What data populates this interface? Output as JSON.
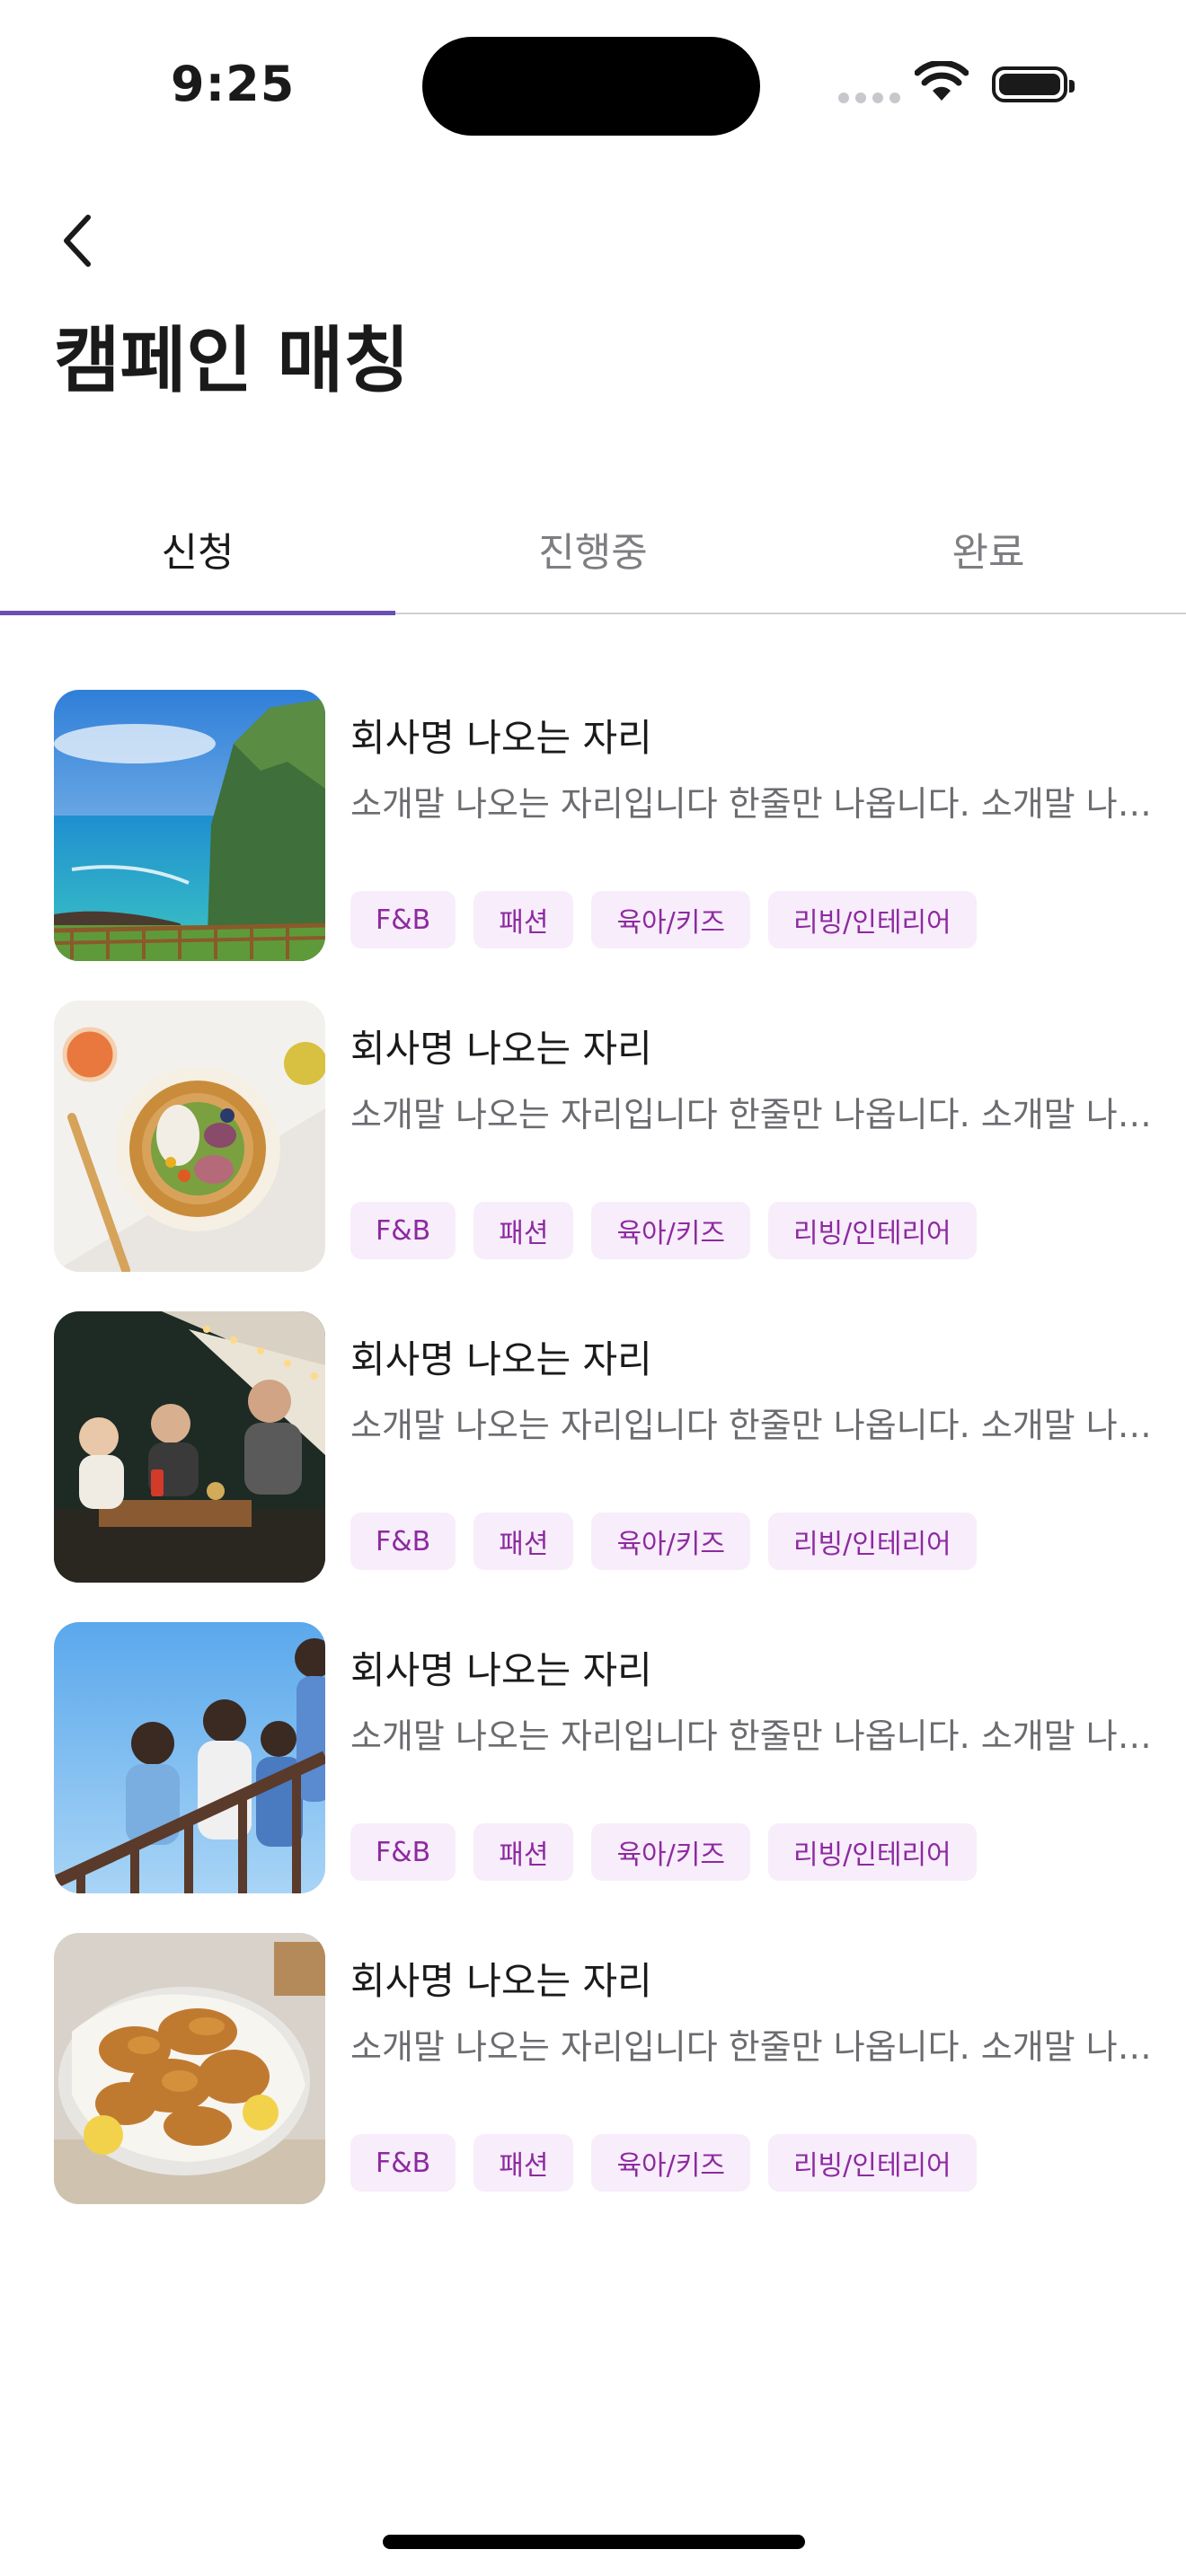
{
  "status": {
    "time": "9:25"
  },
  "header": {
    "title": "캠페인 매칭"
  },
  "tabs": [
    {
      "label": "신청",
      "active": true
    },
    {
      "label": "진행중",
      "active": false
    },
    {
      "label": "완료",
      "active": false
    }
  ],
  "colors": {
    "accent": "#6a4fb5",
    "tag_bg": "#f8edfb",
    "tag_text": "#8d2aa0"
  },
  "items": [
    {
      "title": "회사명 나오는 자리",
      "desc": "소개말 나오는 자리입니다 한줄만 나옵니다. 소개말 나오는 자리입니다",
      "image": "coastal-cliff-photo",
      "tags": [
        "F&B",
        "패션",
        "육아/키즈",
        "리빙/인테리어"
      ]
    },
    {
      "title": "회사명 나오는 자리",
      "desc": "소개말 나오는 자리입니다 한줄만 나옵니다. 소개말 나오는 자리입니다",
      "image": "salad-bowl-photo",
      "tags": [
        "F&B",
        "패션",
        "육아/키즈",
        "리빙/인테리어"
      ]
    },
    {
      "title": "회사명 나오는 자리",
      "desc": "소개말 나오는 자리입니다 한줄만 나옵니다. 소개말 나오는 자리입니다",
      "image": "family-camping-photo",
      "tags": [
        "F&B",
        "패션",
        "육아/키즈",
        "리빙/인테리어"
      ]
    },
    {
      "title": "회사명 나오는 자리",
      "desc": "소개말 나오는 자리입니다 한줄만 나옵니다. 소개말 나오는 자리입니다",
      "image": "family-balcony-photo",
      "tags": [
        "F&B",
        "패션",
        "육아/키즈",
        "리빙/인테리어"
      ]
    },
    {
      "title": "회사명 나오는 자리",
      "desc": "소개말 나오는 자리입니다 한줄만 나옵니다. 소개말 나오는 자리입니다",
      "image": "fried-chicken-photo",
      "tags": [
        "F&B",
        "패션",
        "육아/키즈",
        "리빙/인테리어"
      ]
    }
  ]
}
